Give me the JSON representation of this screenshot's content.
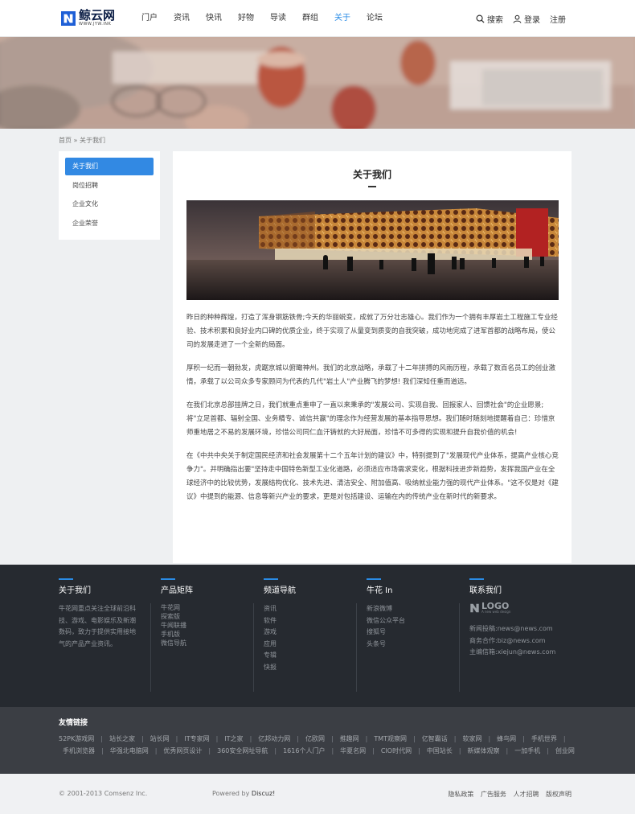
{
  "header": {
    "logo_cn": "鲸云网",
    "logo_en": "WWW.JYW.INK",
    "nav": [
      "门户",
      "资讯",
      "快讯",
      "好物",
      "导读",
      "群组",
      "关于",
      "论坛"
    ],
    "active_nav": "关于",
    "search_label": "搜索",
    "login_label": "登录",
    "register_label": "注册"
  },
  "breadcrumb": {
    "home": "首页",
    "sep": "»",
    "current": "关于我们"
  },
  "side_menu": [
    "关于我们",
    "岗位招聘",
    "企业文化",
    "企业荣誉"
  ],
  "content": {
    "title": "关于我们",
    "paragraphs": [
      "昨日的种种辉煌，打造了浑身钢筋铁骨;今天的华丽蜕变，成就了万分壮志雄心。我们作为一个拥有丰厚岩土工程施工专业经验、技术积累和良好业内口碑的优质企业，终于实现了从量变到质变的自我突破，成功地完成了进军首都的战略布局，使公司的发展走进了一个全新的局面。",
      "厚积一纪而一朝勃发，虎踞京城以俯瞰神州。我们的北京战略，承载了十二年拼搏的风雨历程，承载了数百名员工的创业激情，承载了以公司众多专家顾问为代表的几代\"岩土人\"产业腾飞的梦想! 我们深知任重而道远。",
      "在我们北京总部挂牌之日，我们就重点重申了一直以来秉承的\"发展公司、实现自我、回报家人、回馈社会\"的企业愿景;将\"立足首都、辐射全国、业务精专、诚信共赢\"的理念作为经营发展的基本指导思想。我们随时随刻地提醒着自己：珍惜京师重地居之不易的发展环境，珍惜公司同仁血汗铸就的大好局面，珍惜不可多得的实现和提升自我价值的机会!",
      "在《中共中央关于制定国民经济和社会发展第十二个五年计划的建议》中，特别提到了\"发展现代产业体系，提高产业核心竞争力\"。并明确指出要\"坚持走中国特色新型工业化道路，必须适应市场需求变化，根据科技进步新趋势，发挥我国产业在全球经济中的比较优势，发展结构优化、技术先进、清洁安全、附加值高、吸纳就业能力强的现代产业体系。\"这不仅是对《建议》中提到的能源、信息等新兴产业的要求，更是对包括建设、运输在内的传统产业在新时代的新要求。"
    ]
  },
  "footer": {
    "about": {
      "title": "关于我们",
      "text": "牛花网重点关注全球前沿科技、游戏、电影娱乐及新潮数码，致力于提供实用接地气的产品产业资讯。"
    },
    "products": {
      "title": "产品矩阵",
      "items": [
        "牛花网",
        "探索版",
        "牛闻联播",
        "手机版",
        "微信导航"
      ]
    },
    "channels": {
      "title": "频道导航",
      "items": [
        "资讯",
        "软件",
        "游戏",
        "应用",
        "专辑",
        "快报"
      ]
    },
    "niuhua": {
      "title": "牛花 In",
      "items": [
        "新浪微博",
        "微信公众平台",
        "搜狐号",
        "头条号"
      ]
    },
    "contact": {
      "title": "联系我们",
      "logo_text": "LOGO",
      "logo_sub": "A new web design",
      "lines": [
        "新闻投稿:news@news.com",
        "商务合作:biz@news.com",
        "主编信箱:xiejun@news.com"
      ]
    }
  },
  "links": {
    "title": "友情链接",
    "row1": [
      "52PK游戏网",
      "站长之家",
      "站长网",
      "IT专家网",
      "IT之家",
      "亿邦动力网",
      "亿欧网",
      "推趣网",
      "TMT观察网",
      "亿智霸话",
      "软家网",
      "蜂鸟网",
      "手机世界"
    ],
    "row2": [
      "手机浏览器",
      "华强北电脑网",
      "优秀网页设计",
      "360安全网址导航",
      "1616个人门户",
      "华夏名网",
      "CIO时代网",
      "中国站长",
      "新媒体观察",
      "一加手机",
      "创业网"
    ]
  },
  "copyright": {
    "left": "© 2001-2013 Comsenz Inc.",
    "powered": "Powered by",
    "brand": "Discuz!",
    "right": [
      "隐私政策",
      "广告服务",
      "人才招聘",
      "版权声明"
    ]
  },
  "colors": {
    "accent": "#2a8ce6",
    "footer_bg": "#262a30",
    "links_bg": "#3b3e44"
  }
}
